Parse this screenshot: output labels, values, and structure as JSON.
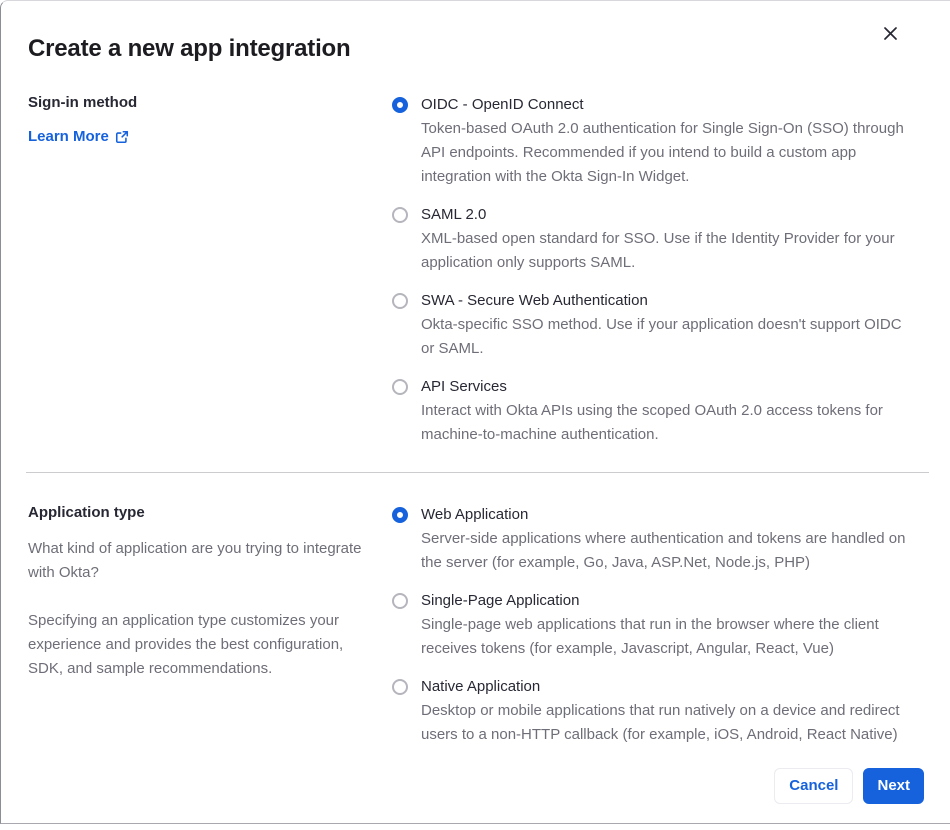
{
  "dialog": {
    "title": "Create a new app integration"
  },
  "signin": {
    "label": "Sign-in method",
    "learn_more_label": "Learn More",
    "options": [
      {
        "label": "OIDC - OpenID Connect",
        "desc": "Token-based OAuth 2.0 authentication for Single Sign-On (SSO) through API endpoints. Recommended if you intend to build a custom app integration with the Okta Sign-In Widget.",
        "selected": true
      },
      {
        "label": "SAML 2.0",
        "desc": "XML-based open standard for SSO. Use if the Identity Provider for your application only supports SAML.",
        "selected": false
      },
      {
        "label": "SWA - Secure Web Authentication",
        "desc": "Okta-specific SSO method. Use if your application doesn't support OIDC or SAML.",
        "selected": false
      },
      {
        "label": "API Services",
        "desc": "Interact with Okta APIs using the scoped OAuth 2.0 access tokens for machine-to-machine authentication.",
        "selected": false
      }
    ]
  },
  "apptype": {
    "label": "Application type",
    "para1": "What kind of application are you trying to integrate with Okta?",
    "para2": "Specifying an application type customizes your experience and provides the best configuration, SDK, and sample recommendations.",
    "options": [
      {
        "label": "Web Application",
        "desc": "Server-side applications where authentication and tokens are handled on the server (for example, Go, Java, ASP.Net, Node.js, PHP)",
        "selected": true
      },
      {
        "label": "Single-Page Application",
        "desc": "Single-page web applications that run in the browser where the client receives tokens (for example, Javascript, Angular, React, Vue)",
        "selected": false
      },
      {
        "label": "Native Application",
        "desc": "Desktop or mobile applications that run natively on a device and redirect users to a non-HTTP callback (for example, iOS, Android, React Native)",
        "selected": false
      }
    ]
  },
  "footer": {
    "cancel_label": "Cancel",
    "next_label": "Next"
  },
  "colors": {
    "accent": "#1662dd",
    "heading": "#1d1d21",
    "body_text": "#6e6e78"
  }
}
